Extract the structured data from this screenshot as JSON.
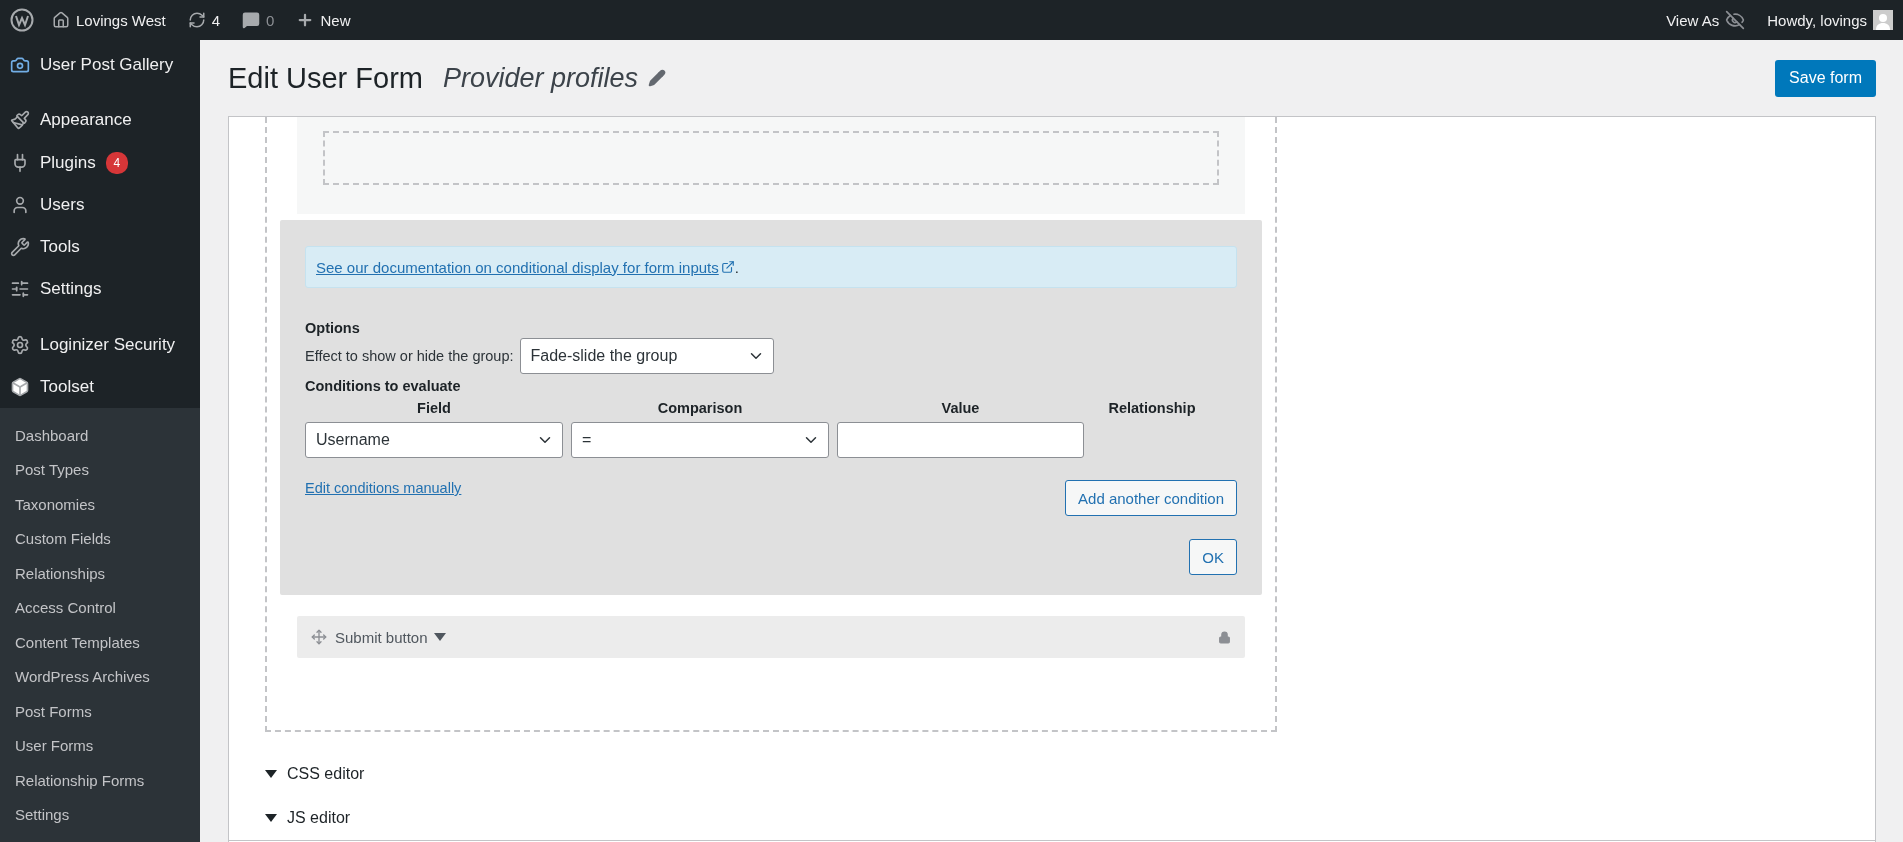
{
  "admin_bar": {
    "site": "Lovings West",
    "updates": "4",
    "comments": "0",
    "new": "New",
    "view_as": "View As",
    "howdy": "Howdy, lovings"
  },
  "sidebar": {
    "items": [
      {
        "label": "User Post Gallery"
      },
      {
        "label": "Appearance"
      },
      {
        "label": "Plugins",
        "badge": "4"
      },
      {
        "label": "Users"
      },
      {
        "label": "Tools"
      },
      {
        "label": "Settings"
      },
      {
        "label": "Loginizer Security"
      },
      {
        "label": "Toolset"
      }
    ],
    "submenu": [
      "Dashboard",
      "Post Types",
      "Taxonomies",
      "Custom Fields",
      "Relationships",
      "Access Control",
      "Content Templates",
      "WordPress Archives",
      "Post Forms",
      "User Forms",
      "Relationship Forms",
      "Settings"
    ]
  },
  "header": {
    "title": "Edit User Form",
    "form_name": "Provider profiles",
    "save": "Save form"
  },
  "conditional": {
    "doc_link": "See our documentation on conditional display for form inputs",
    "doc_suffix": ".",
    "options_label": "Options",
    "effect_label": "Effect to show or hide the group:",
    "effect_value": "Fade-slide the group",
    "conditions_label": "Conditions to evaluate",
    "columns": [
      "Field",
      "Comparison",
      "Value",
      "Relationship"
    ],
    "condition": {
      "field": "Username",
      "comparison": "="
    },
    "edit_manually": "Edit conditions manually",
    "add_condition": "Add another condition",
    "ok": "OK"
  },
  "submit_row": {
    "label": "Submit button"
  },
  "editors": [
    "CSS editor",
    "JS editor"
  ]
}
